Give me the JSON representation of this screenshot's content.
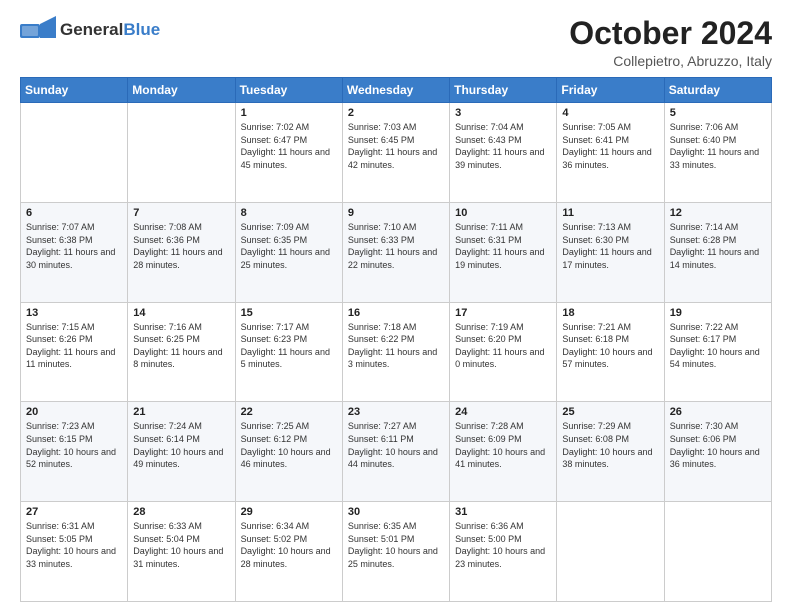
{
  "header": {
    "logo_general": "General",
    "logo_blue": "Blue",
    "month_title": "October 2024",
    "location": "Collepietro, Abruzzo, Italy"
  },
  "days_of_week": [
    "Sunday",
    "Monday",
    "Tuesday",
    "Wednesday",
    "Thursday",
    "Friday",
    "Saturday"
  ],
  "weeks": [
    [
      {
        "day": "",
        "text": ""
      },
      {
        "day": "",
        "text": ""
      },
      {
        "day": "1",
        "text": "Sunrise: 7:02 AM\nSunset: 6:47 PM\nDaylight: 11 hours and 45 minutes."
      },
      {
        "day": "2",
        "text": "Sunrise: 7:03 AM\nSunset: 6:45 PM\nDaylight: 11 hours and 42 minutes."
      },
      {
        "day": "3",
        "text": "Sunrise: 7:04 AM\nSunset: 6:43 PM\nDaylight: 11 hours and 39 minutes."
      },
      {
        "day": "4",
        "text": "Sunrise: 7:05 AM\nSunset: 6:41 PM\nDaylight: 11 hours and 36 minutes."
      },
      {
        "day": "5",
        "text": "Sunrise: 7:06 AM\nSunset: 6:40 PM\nDaylight: 11 hours and 33 minutes."
      }
    ],
    [
      {
        "day": "6",
        "text": "Sunrise: 7:07 AM\nSunset: 6:38 PM\nDaylight: 11 hours and 30 minutes."
      },
      {
        "day": "7",
        "text": "Sunrise: 7:08 AM\nSunset: 6:36 PM\nDaylight: 11 hours and 28 minutes."
      },
      {
        "day": "8",
        "text": "Sunrise: 7:09 AM\nSunset: 6:35 PM\nDaylight: 11 hours and 25 minutes."
      },
      {
        "day": "9",
        "text": "Sunrise: 7:10 AM\nSunset: 6:33 PM\nDaylight: 11 hours and 22 minutes."
      },
      {
        "day": "10",
        "text": "Sunrise: 7:11 AM\nSunset: 6:31 PM\nDaylight: 11 hours and 19 minutes."
      },
      {
        "day": "11",
        "text": "Sunrise: 7:13 AM\nSunset: 6:30 PM\nDaylight: 11 hours and 17 minutes."
      },
      {
        "day": "12",
        "text": "Sunrise: 7:14 AM\nSunset: 6:28 PM\nDaylight: 11 hours and 14 minutes."
      }
    ],
    [
      {
        "day": "13",
        "text": "Sunrise: 7:15 AM\nSunset: 6:26 PM\nDaylight: 11 hours and 11 minutes."
      },
      {
        "day": "14",
        "text": "Sunrise: 7:16 AM\nSunset: 6:25 PM\nDaylight: 11 hours and 8 minutes."
      },
      {
        "day": "15",
        "text": "Sunrise: 7:17 AM\nSunset: 6:23 PM\nDaylight: 11 hours and 5 minutes."
      },
      {
        "day": "16",
        "text": "Sunrise: 7:18 AM\nSunset: 6:22 PM\nDaylight: 11 hours and 3 minutes."
      },
      {
        "day": "17",
        "text": "Sunrise: 7:19 AM\nSunset: 6:20 PM\nDaylight: 11 hours and 0 minutes."
      },
      {
        "day": "18",
        "text": "Sunrise: 7:21 AM\nSunset: 6:18 PM\nDaylight: 10 hours and 57 minutes."
      },
      {
        "day": "19",
        "text": "Sunrise: 7:22 AM\nSunset: 6:17 PM\nDaylight: 10 hours and 54 minutes."
      }
    ],
    [
      {
        "day": "20",
        "text": "Sunrise: 7:23 AM\nSunset: 6:15 PM\nDaylight: 10 hours and 52 minutes."
      },
      {
        "day": "21",
        "text": "Sunrise: 7:24 AM\nSunset: 6:14 PM\nDaylight: 10 hours and 49 minutes."
      },
      {
        "day": "22",
        "text": "Sunrise: 7:25 AM\nSunset: 6:12 PM\nDaylight: 10 hours and 46 minutes."
      },
      {
        "day": "23",
        "text": "Sunrise: 7:27 AM\nSunset: 6:11 PM\nDaylight: 10 hours and 44 minutes."
      },
      {
        "day": "24",
        "text": "Sunrise: 7:28 AM\nSunset: 6:09 PM\nDaylight: 10 hours and 41 minutes."
      },
      {
        "day": "25",
        "text": "Sunrise: 7:29 AM\nSunset: 6:08 PM\nDaylight: 10 hours and 38 minutes."
      },
      {
        "day": "26",
        "text": "Sunrise: 7:30 AM\nSunset: 6:06 PM\nDaylight: 10 hours and 36 minutes."
      }
    ],
    [
      {
        "day": "27",
        "text": "Sunrise: 6:31 AM\nSunset: 5:05 PM\nDaylight: 10 hours and 33 minutes."
      },
      {
        "day": "28",
        "text": "Sunrise: 6:33 AM\nSunset: 5:04 PM\nDaylight: 10 hours and 31 minutes."
      },
      {
        "day": "29",
        "text": "Sunrise: 6:34 AM\nSunset: 5:02 PM\nDaylight: 10 hours and 28 minutes."
      },
      {
        "day": "30",
        "text": "Sunrise: 6:35 AM\nSunset: 5:01 PM\nDaylight: 10 hours and 25 minutes."
      },
      {
        "day": "31",
        "text": "Sunrise: 6:36 AM\nSunset: 5:00 PM\nDaylight: 10 hours and 23 minutes."
      },
      {
        "day": "",
        "text": ""
      },
      {
        "day": "",
        "text": ""
      }
    ]
  ]
}
